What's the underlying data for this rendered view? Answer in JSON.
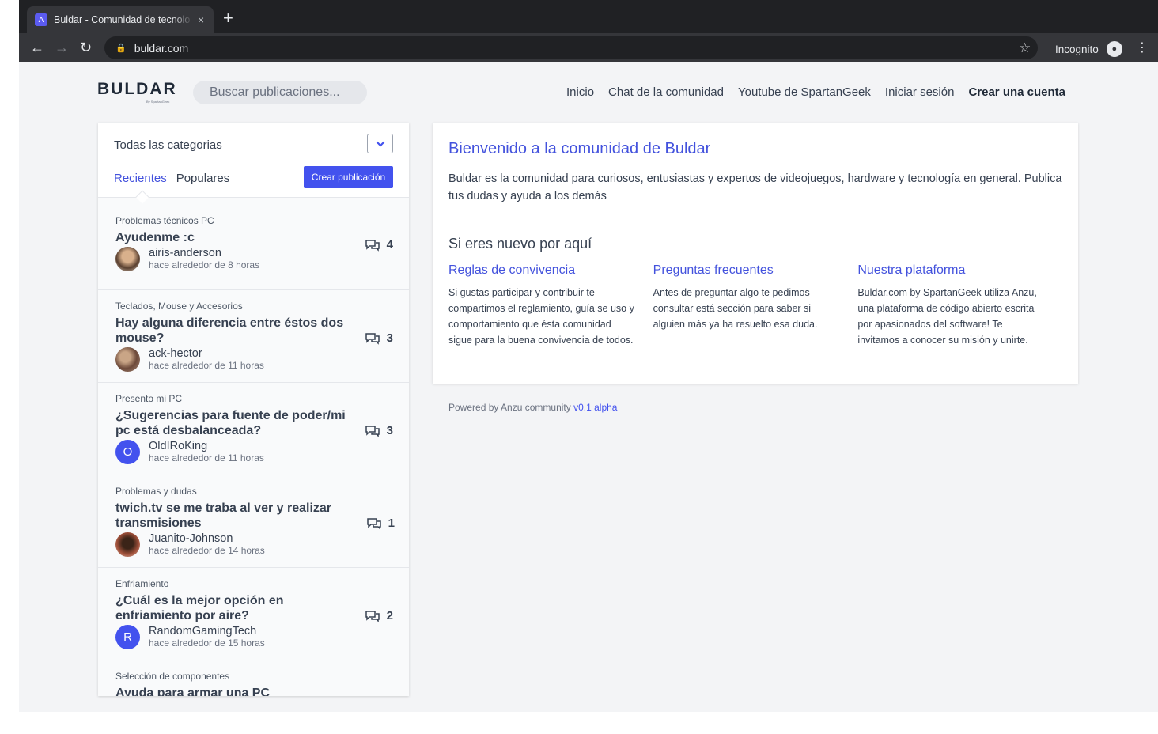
{
  "browser": {
    "tab_title": "Buldar - Comunidad de tecnolo",
    "tab_close": "×",
    "new_tab": "+",
    "url": "buldar.com",
    "incognito_label": "Incognito"
  },
  "header": {
    "logo": "BULDAR",
    "logo_sub": "By SpartanGeek",
    "search_placeholder": "Buscar publicaciones...",
    "nav": [
      "Inicio",
      "Chat de la comunidad",
      "Youtube de SpartanGeek",
      "Iniciar sesión",
      "Crear una cuenta"
    ]
  },
  "sidebar": {
    "category_label": "Todas las categorias",
    "tabs": [
      "Recientes",
      "Populares"
    ],
    "create_button": "Crear publicación",
    "posts": [
      {
        "category": "Problemas técnicos PC",
        "title": "Ayudenme :c",
        "author": "airis-anderson",
        "time": "hace alrededor de 8 horas",
        "comments": "4",
        "avatar_letter": "",
        "avatar_color": "#8b6f4e"
      },
      {
        "category": "Teclados, Mouse y Accesorios",
        "title": "Hay alguna diferencia entre éstos dos mouse?",
        "author": "ack-hector",
        "time": "hace alrededor de 11 horas",
        "comments": "3",
        "avatar_letter": "",
        "avatar_color": "#7a5a4a"
      },
      {
        "category": "Presento mi PC",
        "title": "¿Sugerencias para fuente de poder/mi pc está desbalanceada?",
        "author": "OldIRoKing",
        "time": "hace alrededor de 11 horas",
        "comments": "3",
        "avatar_letter": "O",
        "avatar_color": "#4352ee"
      },
      {
        "category": "Problemas y dudas",
        "title": "twich.tv se me traba al ver y realizar transmisiones",
        "author": "Juanito-Johnson",
        "time": "hace alrededor de 14 horas",
        "comments": "1",
        "avatar_letter": "",
        "avatar_color": "#8a3b2a"
      },
      {
        "category": "Enfriamiento",
        "title": "¿Cuál es la mejor opción en enfriamiento por aire?",
        "author": "RandomGamingTech",
        "time": "hace alrededor de 15 horas",
        "comments": "2",
        "avatar_letter": "R",
        "avatar_color": "#4352ee"
      },
      {
        "category": "Selección de componentes",
        "title": "Ayuda para armar una PC",
        "author": "",
        "time": "",
        "comments": "",
        "avatar_letter": "",
        "avatar_color": "#4352ee"
      }
    ]
  },
  "welcome": {
    "title": "Bienvenido a la comunidad de Buldar",
    "intro": "Buldar es la comunidad para curiosos, entusiastas y expertos de videojuegos, hardware y tecnología en general. Publica tus dudas y ayuda a los demás",
    "subtitle": "Si eres nuevo por aquí",
    "columns": [
      {
        "heading": "Reglas de convivencia",
        "text": "Si gustas participar y contribuir te compartimos el reglamiento, guía se uso y comportamiento que ésta comunidad sigue para la buena convivencia de todos."
      },
      {
        "heading": "Preguntas frecuentes",
        "text": "Antes de preguntar algo te pedimos consultar está sección para saber si alguien más ya ha resuelto esa duda."
      },
      {
        "heading": "Nuestra plataforma",
        "text": "Buldar.com by SpartanGeek utiliza Anzu, una plataforma de código abierto escrita por apasionados del software! Te invitamos a conocer su misión y unirte."
      }
    ]
  },
  "footer": {
    "powered": "Powered by Anzu community",
    "version": "v0.1 alpha"
  },
  "colors": {
    "accent": "#4352ee",
    "link": "#4352dd",
    "background": "#f3f4f6"
  }
}
